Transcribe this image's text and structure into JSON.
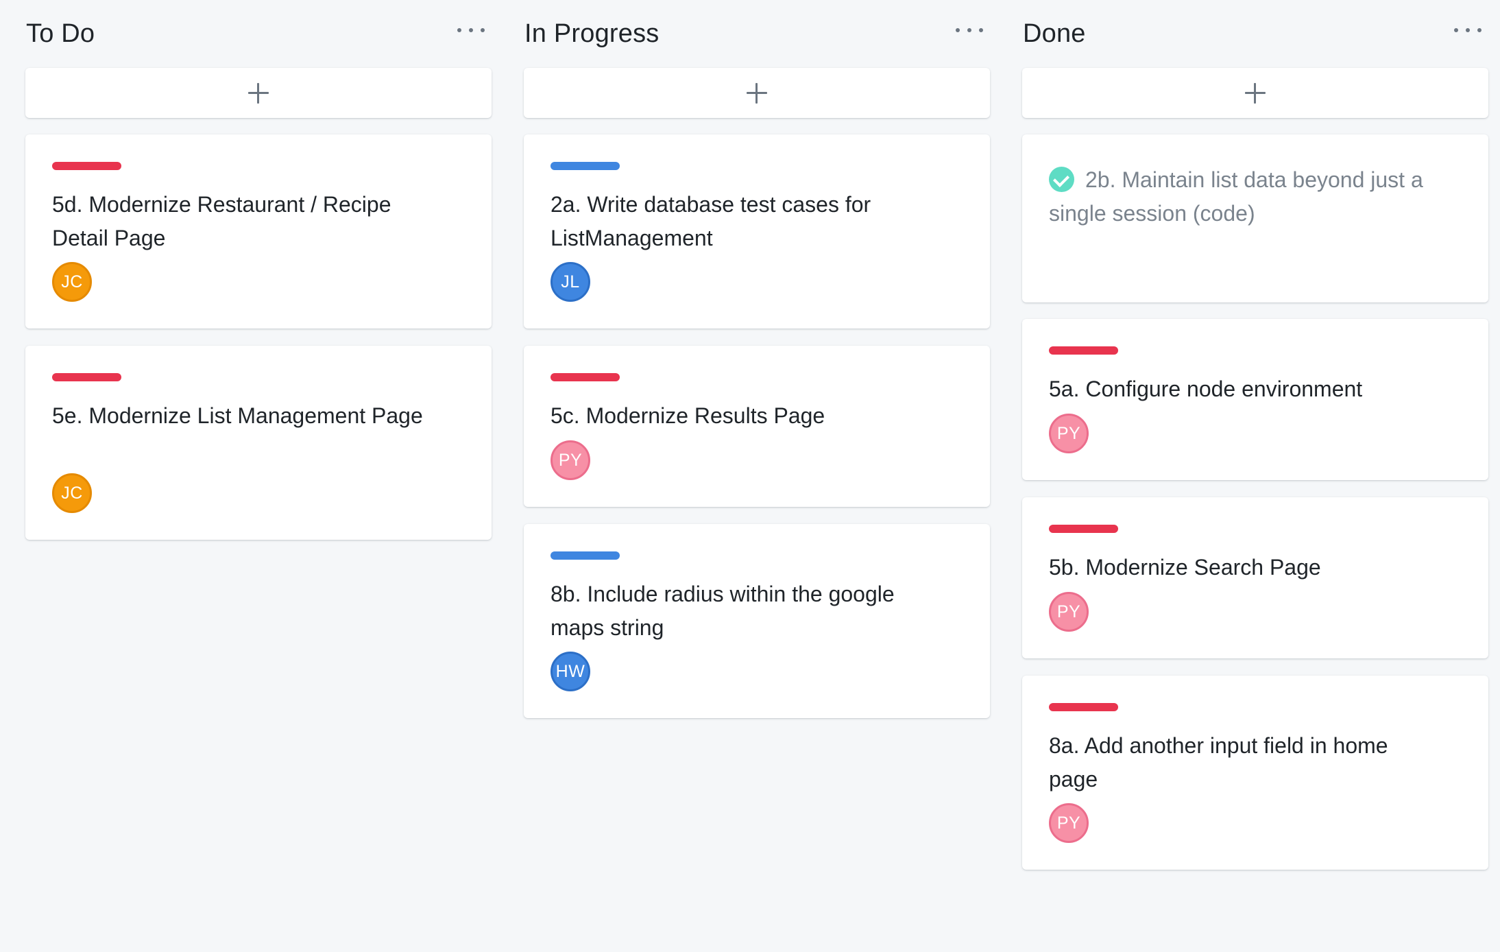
{
  "board": {
    "columns": [
      {
        "title": "To Do",
        "cards": [
          {
            "title": "5d. Modernize Restaurant / Recipe Detail Page",
            "label_color": "#e8344e",
            "assignee": "JC"
          },
          {
            "title": "5e. Modernize List Management Page",
            "label_color": "#e8344e",
            "assignee": "JC"
          }
        ]
      },
      {
        "title": "In Progress",
        "cards": [
          {
            "title": "2a. Write database test cases for ListManagement",
            "label_color": "#3f86e0",
            "assignee": "JL"
          },
          {
            "title": "5c. Modernize Results Page",
            "label_color": "#e8344e",
            "assignee": "PY"
          },
          {
            "title": "8b. Include radius within the google maps string",
            "label_color": "#3f86e0",
            "assignee": "HW"
          }
        ]
      },
      {
        "title": "Done",
        "cards": [
          {
            "title": "2b. Maintain list data beyond just a single session (code)",
            "completed": true,
            "icon": "check-circle-icon"
          },
          {
            "title": "5a. Configure node environment",
            "label_color": "#e8344e",
            "assignee": "PY"
          },
          {
            "title": "5b. Modernize Search Page",
            "label_color": "#e8344e",
            "assignee": "PY"
          },
          {
            "title": "8a. Add another input field in home page",
            "label_color": "#e8344e",
            "assignee": "PY"
          }
        ]
      }
    ]
  },
  "colors": {
    "background": "#f5f7f9",
    "label_red": "#e8344e",
    "label_blue": "#3f86e0",
    "avatar_orange": "#f59a0a",
    "avatar_blue": "#3f86e0",
    "avatar_pink": "#f790a6",
    "check_teal": "#5edcc4"
  }
}
